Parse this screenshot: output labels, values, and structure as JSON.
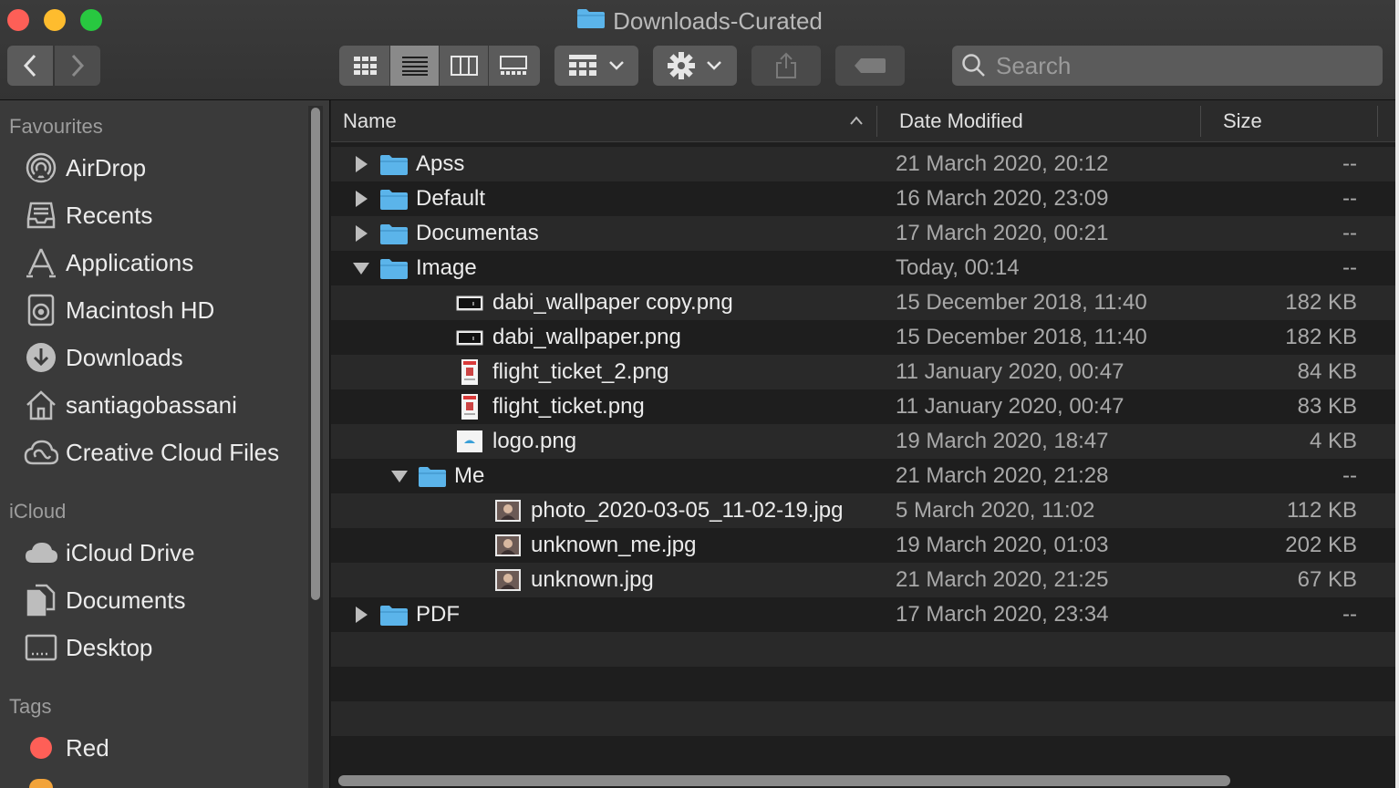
{
  "window": {
    "title": "Downloads-Curated"
  },
  "toolbar": {
    "back_icon": "chevron-left-icon",
    "forward_icon": "chevron-right-icon",
    "view_modes": [
      "icon-view",
      "list-view",
      "column-view",
      "gallery-view"
    ],
    "active_view": "list-view",
    "search_placeholder": "Search",
    "search_value": ""
  },
  "sidebar": {
    "favourites_header": "Favourites",
    "favourites": [
      {
        "label": "AirDrop",
        "icon": "airdrop-icon"
      },
      {
        "label": "Recents",
        "icon": "recents-icon"
      },
      {
        "label": "Applications",
        "icon": "applications-icon"
      },
      {
        "label": "Macintosh HD",
        "icon": "hard-drive-icon"
      },
      {
        "label": "Downloads",
        "icon": "downloads-icon"
      },
      {
        "label": "santiagobassani",
        "icon": "home-icon"
      },
      {
        "label": "Creative Cloud Files",
        "icon": "creative-cloud-icon"
      }
    ],
    "icloud_header": "iCloud",
    "icloud": [
      {
        "label": "iCloud Drive",
        "icon": "cloud-icon"
      },
      {
        "label": "Documents",
        "icon": "documents-icon"
      },
      {
        "label": "Desktop",
        "icon": "desktop-icon"
      }
    ],
    "tags_header": "Tags",
    "tags": [
      {
        "label": "Red",
        "color": "#fe5f57"
      }
    ]
  },
  "columns": {
    "name": "Name",
    "date": "Date Modified",
    "size": "Size"
  },
  "files": [
    {
      "name": "Apss",
      "date": "21 March 2020, 20:12",
      "size": "--",
      "kind": "folder",
      "depth": 0,
      "expanded": false
    },
    {
      "name": "Default",
      "date": "16 March 2020, 23:09",
      "size": "--",
      "kind": "folder",
      "depth": 0,
      "expanded": false
    },
    {
      "name": "Documentas",
      "date": "17 March 2020, 00:21",
      "size": "--",
      "kind": "folder",
      "depth": 0,
      "expanded": false
    },
    {
      "name": "Image",
      "date": "Today, 00:14",
      "size": "--",
      "kind": "folder",
      "depth": 0,
      "expanded": true
    },
    {
      "name": "dabi_wallpaper copy.png",
      "date": "15 December 2018, 11:40",
      "size": "182 KB",
      "kind": "image-wide",
      "depth": 1
    },
    {
      "name": "dabi_wallpaper.png",
      "date": "15 December 2018, 11:40",
      "size": "182 KB",
      "kind": "image-wide",
      "depth": 1
    },
    {
      "name": "flight_ticket_2.png",
      "date": "11 January 2020, 00:47",
      "size": "84 KB",
      "kind": "ticket",
      "depth": 1
    },
    {
      "name": "flight_ticket.png",
      "date": "11 January 2020, 00:47",
      "size": "83 KB",
      "kind": "ticket",
      "depth": 1
    },
    {
      "name": "logo.png",
      "date": "19 March 2020, 18:47",
      "size": "4 KB",
      "kind": "logo",
      "depth": 1
    },
    {
      "name": "Me",
      "date": "21 March 2020, 21:28",
      "size": "--",
      "kind": "folder",
      "depth": 1,
      "expanded": true
    },
    {
      "name": "photo_2020-03-05_11-02-19.jpg",
      "date": "5 March 2020, 11:02",
      "size": "112 KB",
      "kind": "photo",
      "depth": 2
    },
    {
      "name": "unknown_me.jpg",
      "date": "19 March 2020, 01:03",
      "size": "202 KB",
      "kind": "photo",
      "depth": 2
    },
    {
      "name": "unknown.jpg",
      "date": "21 March 2020, 21:25",
      "size": "67 KB",
      "kind": "photo",
      "depth": 2
    },
    {
      "name": "PDF",
      "date": "17 March 2020, 23:34",
      "size": "--",
      "kind": "folder",
      "depth": 0,
      "expanded": false
    }
  ],
  "colors": {
    "folder": "#5bb4ea",
    "accent": "#8a8a8a",
    "tag_red": "#fe5f57"
  }
}
